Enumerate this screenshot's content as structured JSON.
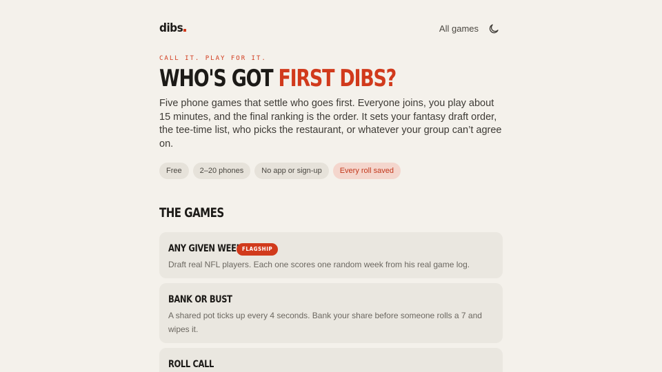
{
  "brand": {
    "logo_text": "dibs",
    "accent_color": "#d13a1c"
  },
  "nav": {
    "all_games_label": "All games",
    "theme_icon": "moon-icon"
  },
  "hero": {
    "eyebrow": "CALL IT. PLAY FOR IT.",
    "title_plain": "WHO'S GOT ",
    "title_accent": "FIRST DIBS?",
    "lede": "Five phone games that settle who goes first. Everyone joins, you play about 15 minutes, and the final ranking is the order. It sets your fantasy draft order, the tee-time list, who picks the restaurant, or whatever your group can’t agree on.",
    "pills": [
      {
        "label": "Free",
        "highlight": false
      },
      {
        "label": "2–20 phones",
        "highlight": false
      },
      {
        "label": "No app or sign-up",
        "highlight": false
      },
      {
        "label": "Every roll saved",
        "highlight": true
      }
    ]
  },
  "games": {
    "section_title": "THE GAMES",
    "items": [
      {
        "title": "ANY GIVEN WEEK",
        "badge": "FLAGSHIP",
        "description": "Draft real NFL players. Each one scores one random week from his real game log."
      },
      {
        "title": "BANK OR BUST",
        "badge": "",
        "description": "A shared pot ticks up every 4 seconds. Bank your share before someone rolls a 7 and wipes it."
      },
      {
        "title": "ROLL CALL",
        "badge": "",
        "description": ""
      }
    ]
  }
}
